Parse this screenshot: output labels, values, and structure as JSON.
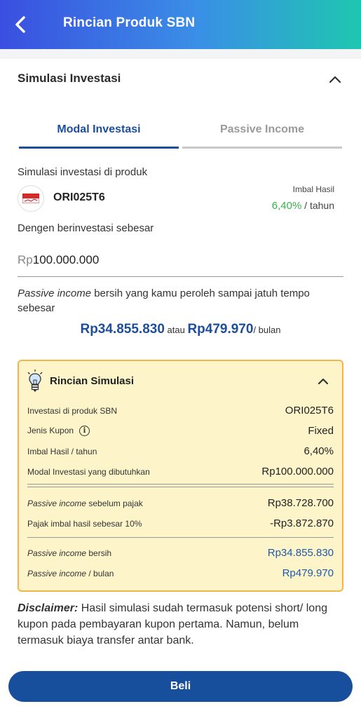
{
  "header": {
    "title": "Rincian Produk SBN",
    "back_icon": "chevron-left-icon"
  },
  "section": {
    "title": "Simulasi Investasi",
    "collapse_icon": "chevron-up-icon"
  },
  "tabs": [
    {
      "label": "Modal Investasi",
      "active": true
    },
    {
      "label": "Passive Income",
      "active": false
    }
  ],
  "simulation": {
    "product_label": "Simulasi investasi di produk",
    "product_name": "ORI025T6",
    "imbal_label": "Imbal Hasil",
    "imbal_rate": "6,40%",
    "imbal_unit": " / tahun",
    "invest_label": "Dengen berinvestasi sebesar",
    "amount_currency": "Rp",
    "amount_value": "100.000.000",
    "passive_italic": "Passive income",
    "passive_text": " bersih yang kamu peroleh sampai jatuh tempo sebesar",
    "result_total": "Rp34.855.830",
    "result_or": " atau ",
    "result_monthly": "Rp479.970",
    "result_unit": "/ bulan"
  },
  "rincian": {
    "title": "Rincian Simulasi",
    "icon": "lightbulb-icon",
    "rows": [
      {
        "label": "Investasi di produk SBN",
        "value": "ORI025T6"
      },
      {
        "label": "Jenis Kupon",
        "value": "Fixed"
      },
      {
        "label": "Imbal Hasil / tahun",
        "value": "6,40%"
      },
      {
        "label": "Modal Investasi yang dibutuhkan",
        "value": "Rp100.000.000"
      },
      {
        "label_italic": "Passive income",
        "label": " sebelum pajak",
        "value": "Rp38.728.700"
      },
      {
        "label": "Pajak imbal hasil sebesar 10%",
        "value": "-Rp3.872.870"
      },
      {
        "label_italic": "Passive income",
        "label": " bersih",
        "value": "Rp34.855.830"
      },
      {
        "label_italic": "Passive income",
        "label": " / bulan",
        "value": "Rp479.970"
      }
    ]
  },
  "disclaimer": {
    "label": "Disclaimer:",
    "text": " Hasil simulasi sudah termasuk potensi short/ long kupon pada pembayaran kupon pertama. Namun, belum termasuk biaya transfer antar bank."
  },
  "buy_button": {
    "label": "Beli"
  },
  "colors": {
    "primary": "#1d4e9c",
    "green": "#38b24a",
    "card_bg": "#fdf5c9",
    "card_border": "#f3b64b"
  }
}
